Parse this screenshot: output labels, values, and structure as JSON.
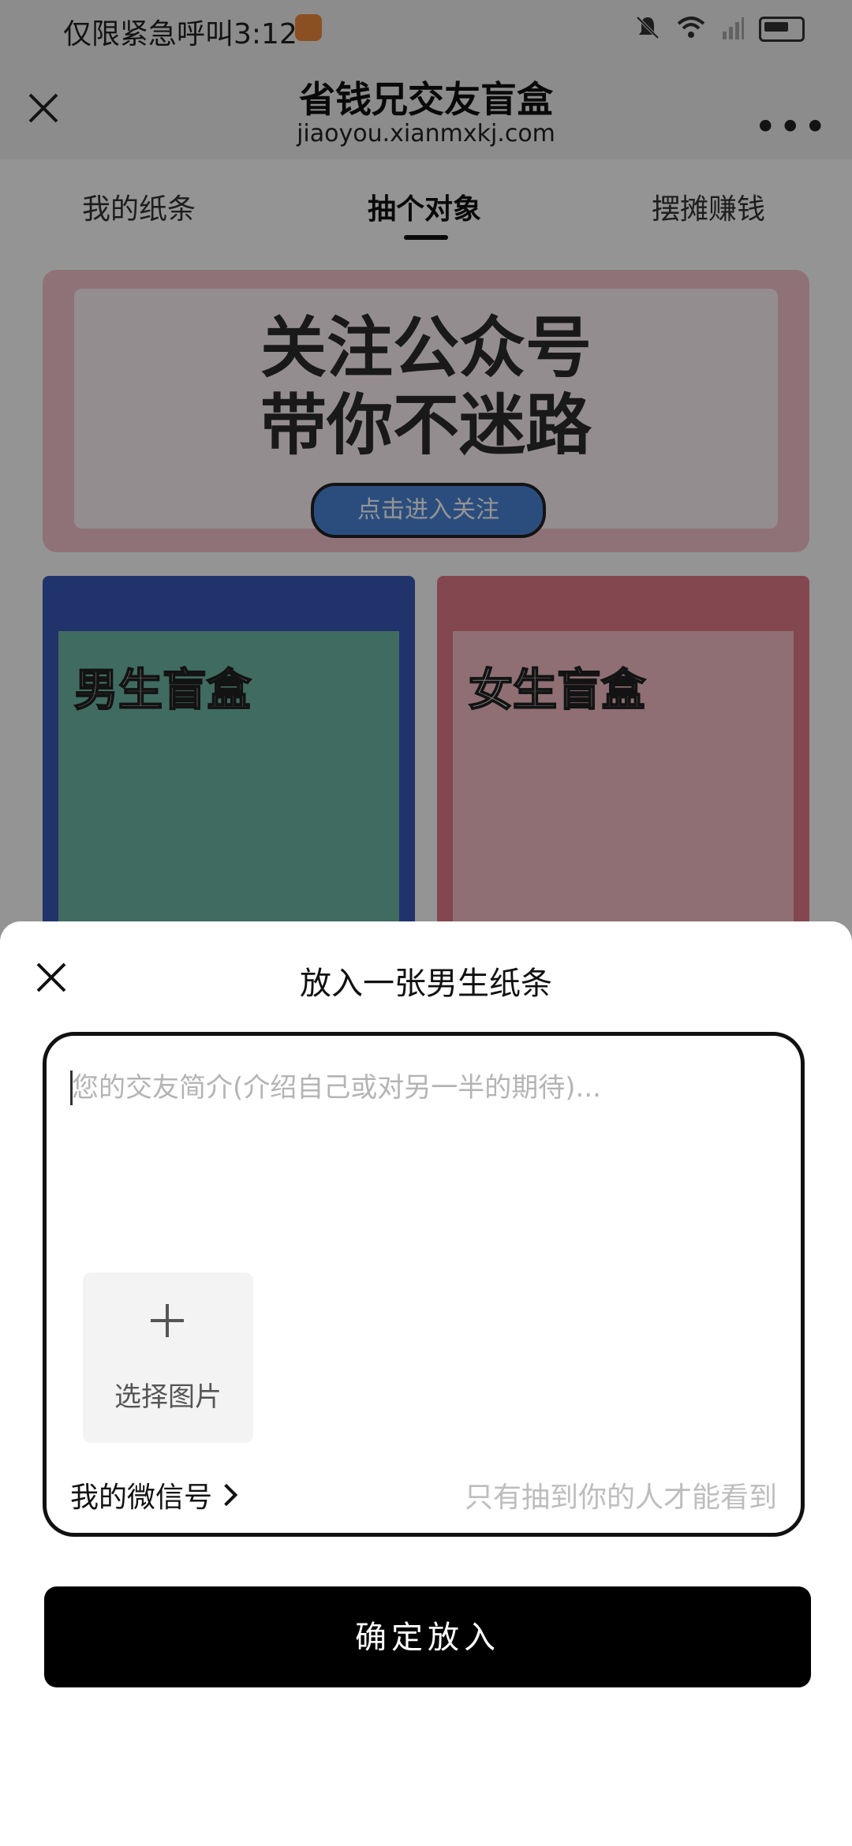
{
  "status_bar": {
    "text": "仅限紧急呼叫3:12"
  },
  "title_bar": {
    "title": "省钱兄交友盲盒",
    "domain": "jiaoyou.xianmxkj.com",
    "more": "•••"
  },
  "tabs": [
    {
      "label": "我的纸条"
    },
    {
      "label": "抽个对象"
    },
    {
      "label": "摆摊赚钱"
    }
  ],
  "banner": {
    "title_line1": "关注公众号",
    "title_line2": "带你不迷路",
    "button": "点击进入关注"
  },
  "boxes": {
    "male": "男生盲盒",
    "female": "女生盲盒"
  },
  "sheet": {
    "title": "放入一张男生纸条",
    "intro_placeholder": "您的交友简介(介绍自己或对另一半的期待)...",
    "upload_label": "选择图片",
    "wechat_label": "我的微信号",
    "wechat_hint": "只有抽到你的人才能看到",
    "confirm": "确定放入"
  }
}
